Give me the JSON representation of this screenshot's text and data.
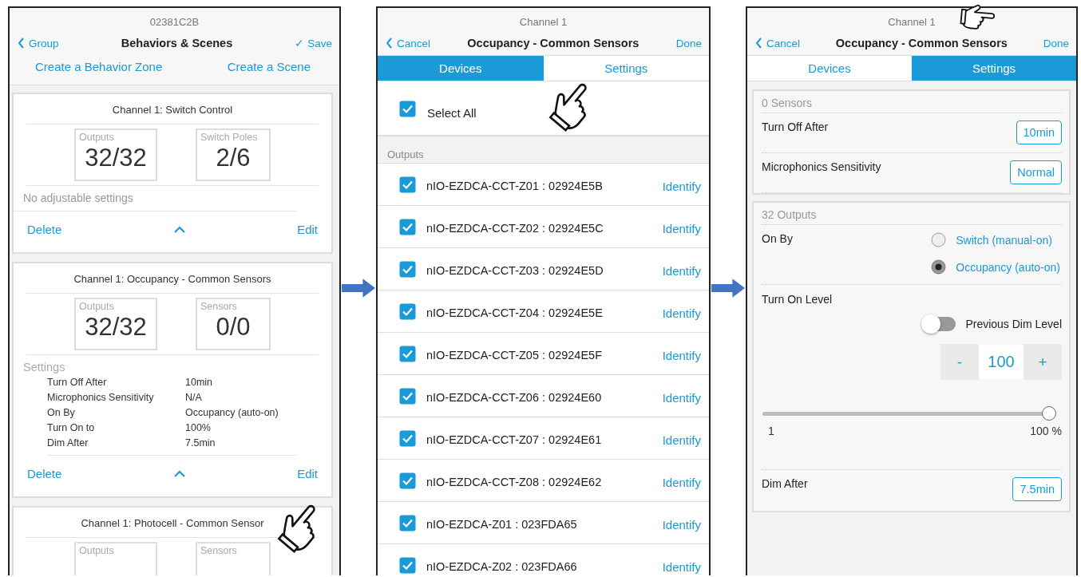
{
  "behaviors_screen": {
    "subtitle": "02381C2B",
    "back": "Group",
    "title": "Behaviors & Scenes",
    "save": "✓ Save",
    "links": [
      "Create a Behavior Zone",
      "Create a Scene"
    ],
    "cards": [
      {
        "title": "Channel 1: Switch Control",
        "stats": [
          {
            "label": "Outputs",
            "value": "32/32"
          },
          {
            "label": "Switch Poles",
            "value": "2/6"
          }
        ],
        "note": "No adjustable settings",
        "delete": "Delete",
        "edit": "Edit"
      },
      {
        "title": "Channel 1: Occupancy - Common Sensors",
        "stats": [
          {
            "label": "Outputs",
            "value": "32/32"
          },
          {
            "label": "Sensors",
            "value": "0/0"
          }
        ],
        "settings_heading": "Settings",
        "settings": [
          {
            "label": "Turn Off After",
            "value": "10min"
          },
          {
            "label": "Microphonics Sensitivity",
            "value": "N/A"
          },
          {
            "label": "On By",
            "value": "Occupancy (auto-on)"
          },
          {
            "label": "Turn On to",
            "value": "100%"
          },
          {
            "label": "Dim After",
            "value": "7.5min"
          }
        ],
        "delete": "Delete",
        "edit": "Edit"
      },
      {
        "title": "Channel 1: Photocell - Common Sensor",
        "stats": [
          {
            "label": "Outputs"
          },
          {
            "label": "Sensors"
          }
        ]
      }
    ]
  },
  "devices_screen": {
    "subtitle": "Channel 1",
    "back": "Cancel",
    "title": "Occupancy - Common Sensors",
    "done": "Done",
    "tabs": [
      {
        "label": "Devices",
        "selected": true
      },
      {
        "label": "Settings",
        "selected": false
      }
    ],
    "select_all": {
      "label": "Select All",
      "checked": true
    },
    "section": "Outputs",
    "outputs": [
      {
        "name": "nIO-EZDCA-CCT-Z01 : 02924E5B",
        "checked": true,
        "action": "Identify"
      },
      {
        "name": "nIO-EZDCA-CCT-Z02 : 02924E5C",
        "checked": true,
        "action": "Identify"
      },
      {
        "name": "nIO-EZDCA-CCT-Z03 : 02924E5D",
        "checked": true,
        "action": "Identify"
      },
      {
        "name": "nIO-EZDCA-CCT-Z04 : 02924E5E",
        "checked": true,
        "action": "Identify"
      },
      {
        "name": "nIO-EZDCA-CCT-Z05 : 02924E5F",
        "checked": true,
        "action": "Identify"
      },
      {
        "name": "nIO-EZDCA-CCT-Z06 : 02924E60",
        "checked": true,
        "action": "Identify"
      },
      {
        "name": "nIO-EZDCA-CCT-Z07 : 02924E61",
        "checked": true,
        "action": "Identify"
      },
      {
        "name": "nIO-EZDCA-CCT-Z08 : 02924E62",
        "checked": true,
        "action": "Identify"
      },
      {
        "name": "nIO-EZDCA-Z01 : 023FDA65",
        "checked": true,
        "action": "Identify"
      },
      {
        "name": "nIO-EZDCA-Z02 : 023FDA66",
        "checked": true,
        "action": "Identify"
      }
    ]
  },
  "settings_screen": {
    "subtitle": "Channel 1",
    "back": "Cancel",
    "title": "Occupancy - Common Sensors",
    "done": "Done",
    "tabs": [
      {
        "label": "Devices",
        "selected": false
      },
      {
        "label": "Settings",
        "selected": true
      }
    ],
    "sensors_card": {
      "heading": "0 Sensors",
      "rows": [
        {
          "label": "Turn Off After",
          "value": "10min"
        },
        {
          "label": "Microphonics Sensitivity",
          "value": "Normal"
        }
      ]
    },
    "outputs_card": {
      "heading": "32 Outputs",
      "on_by": {
        "label": "On By",
        "options": [
          {
            "label": "Switch (manual-on)",
            "selected": false
          },
          {
            "label": "Occupancy (auto-on)",
            "selected": true
          }
        ]
      },
      "turn_on_level": {
        "label": "Turn On Level",
        "toggle": {
          "label": "Previous Dim Level",
          "on": false
        },
        "stepper": {
          "minus": "-",
          "value": "100",
          "plus": "+"
        },
        "slider": {
          "level": 1,
          "min_label": "1",
          "max_label": "100 %"
        }
      },
      "dim_after": {
        "label": "Dim After",
        "value": "7.5min"
      }
    }
  }
}
